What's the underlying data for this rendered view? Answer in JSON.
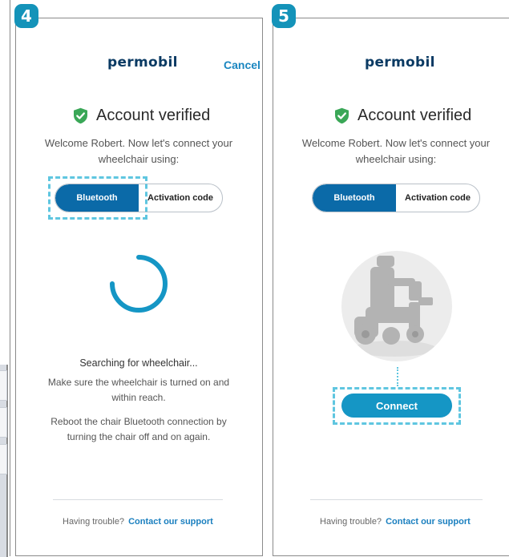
{
  "panel4": {
    "step": "4",
    "logo": "permobil",
    "cancel": "Cancel",
    "verified_title": "Account verified",
    "welcome": "Welcome Robert. Now let's connect your wheelchair using:",
    "toggle": {
      "bluetooth": "Bluetooth",
      "activation": "Activation code"
    },
    "searching": "Searching for wheelchair...",
    "hint1": "Make sure the wheelchair is turned on and within reach.",
    "hint2": "Reboot the chair Bluetooth connection by turning the chair off and on again.",
    "trouble": "Having trouble?",
    "support": "Contact our support"
  },
  "panel5": {
    "step": "5",
    "logo": "permobil",
    "verified_title": "Account verified",
    "welcome": "Welcome Robert. Now let's connect your wheelchair using:",
    "toggle": {
      "bluetooth": "Bluetooth",
      "activation": "Activation code"
    },
    "connect": "Connect",
    "trouble": "Having trouble?",
    "support": "Contact our support"
  },
  "colors": {
    "accent": "#1493b9",
    "toggle_active": "#0b6aa8",
    "verified_green": "#3aa757",
    "highlight_dashed": "#5fc6e0"
  }
}
